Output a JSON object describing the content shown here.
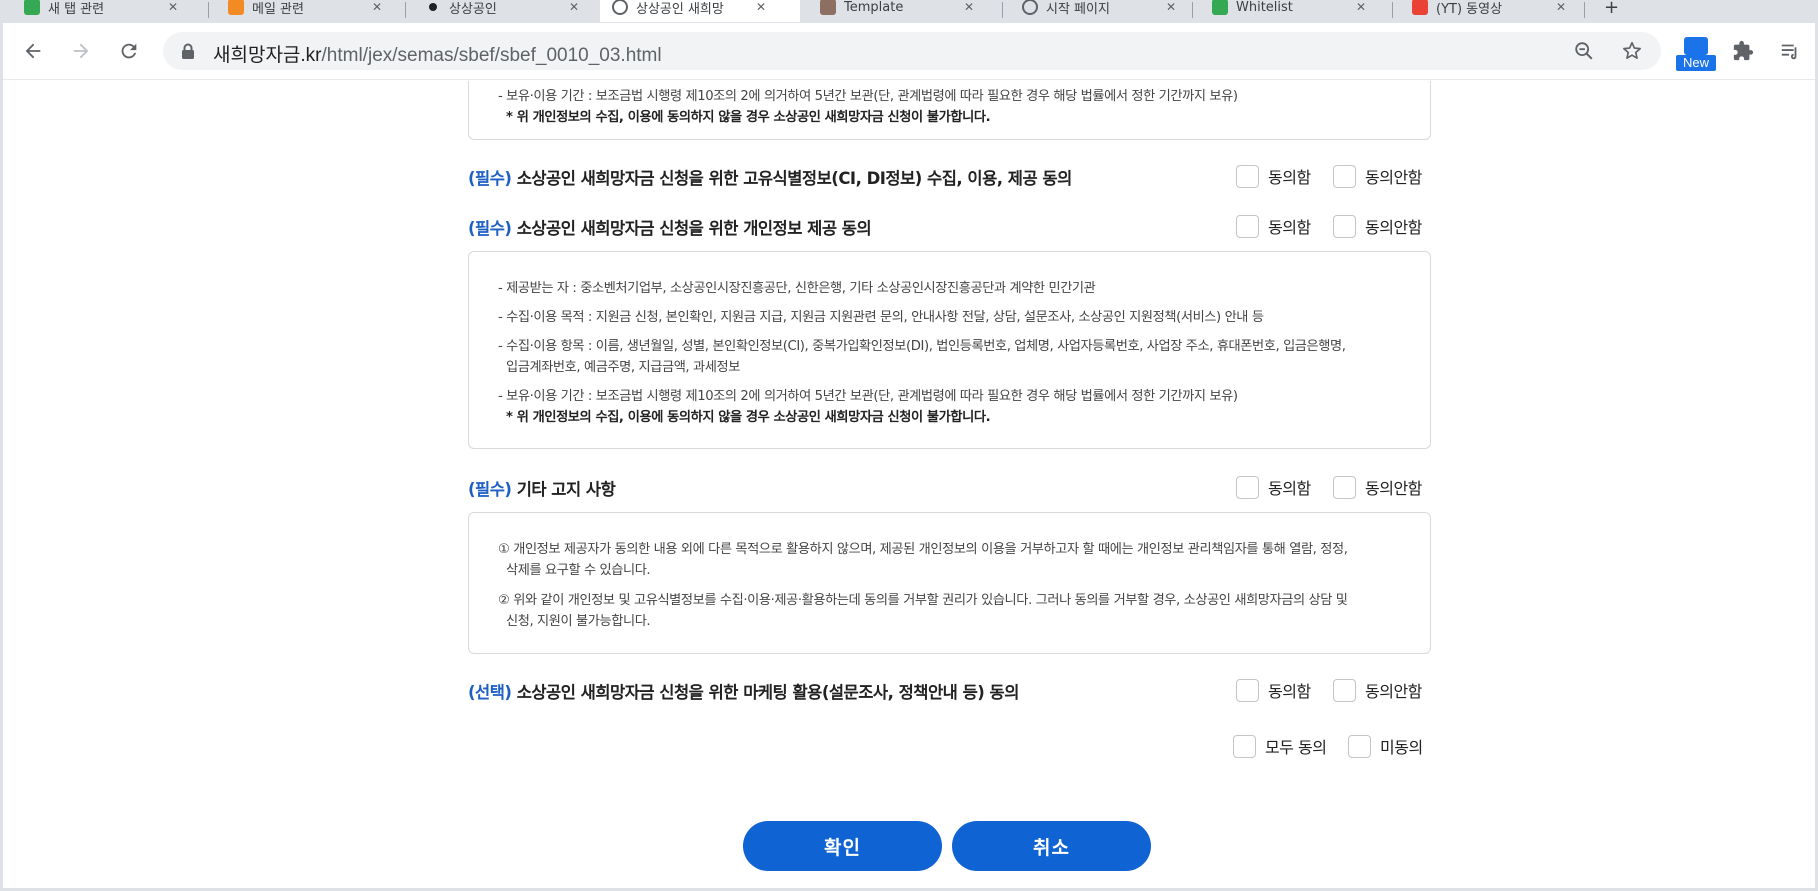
{
  "browser": {
    "tabs": [
      {
        "label": "새 탭 관련",
        "favicon_color": "#34a853"
      },
      {
        "label": "메일 관련",
        "favicon_color": "#f28b24"
      },
      {
        "label": "상상공인",
        "favicon_color": "#202124"
      },
      {
        "label": "상상공인 새희망",
        "favicon_color": "#5f6368"
      },
      {
        "label": "Template",
        "favicon_color": "#8d6e63"
      },
      {
        "label": "시작 페이지",
        "favicon_color": "#5f6368"
      },
      {
        "label": "Whitelist",
        "favicon_color": "#34a853"
      },
      {
        "label": "(YT) 동영상",
        "favicon_color": "#ea4335"
      }
    ],
    "active_tab_index": 3,
    "url_host": "새희망자금.kr",
    "url_path": "/html/jex/semas/sbef/sbef_0010_03.html",
    "new_badge": "New"
  },
  "page": {
    "top_box_lines": [
      "- 보유·이용 기간 : 보조금법 시행령 제10조의 2에 의거하여 5년간 보관(단, 관계법령에 따라 필요한 경우 해당 법률에서 정한 기간까지 보유)",
      "* 위 개인정보의 수집, 이용에 동의하지 않을 경우 소상공인 새희망자금 신청이 불가합니다."
    ],
    "sections": [
      {
        "tag": "(필수)",
        "title": " 소상공인 새희망자금 신청을 위한 고유식별정보(CI, DI정보) 수집, 이용, 제공 동의"
      },
      {
        "tag": "(필수)",
        "title": " 소상공인 새희망자금 신청을 위한 개인정보 제공 동의"
      },
      {
        "tag": "(필수)",
        "title": " 기타 고지 사항"
      },
      {
        "tag": "(선택)",
        "title": " 소상공인 새희망자금 신청을 위한 마케팅 활용(설문조사, 정책안내 등) 동의"
      }
    ],
    "box2_lines": [
      "- 제공받는 자 : 중소벤처기업부, 소상공인시장진흥공단, 신한은행, 기타 소상공인시장진흥공단과 계약한 민간기관",
      "- 수집·이용 목적 : 지원금 신청, 본인확인, 지원금 지급, 지원금 지원관련 문의, 안내사항 전달, 상담, 설문조사, 소상공인 지원정책(서비스) 안내 등",
      "- 수집·이용 항목 : 이름, 생년월일, 성별, 본인확인정보(CI), 중복가입확인정보(DI), 법인등록번호, 업체명, 사업자등록번호, 사업장 주소, 휴대폰번호, 입금은행명,",
      "입금계좌번호, 예금주명, 지급금액, 과세정보",
      "- 보유·이용 기간 : 보조금법 시행령 제10조의 2에 의거하여 5년간 보관(단, 관계법령에 따라 필요한 경우 해당 법률에서 정한 기간까지 보유)",
      "* 위 개인정보의 수집, 이용에 동의하지 않을 경우 소상공인 새희망자금 신청이 불가합니다."
    ],
    "box3_lines": [
      "① 개인정보 제공자가 동의한 내용 외에 다른 목적으로 활용하지 않으며, 제공된 개인정보의 이용을 거부하고자 할 때에는 개인정보 관리책임자를 통해 열람, 정정,",
      "삭제를 요구할 수 있습니다.",
      "② 위와 같이 개인정보 및 고유식별정보를 수집·이용·제공·활용하는데 동의를 거부할 권리가 있습니다. 그러나 동의를 거부할 경우, 소상공인 새희망자금의 상담 및",
      "신청, 지원이 불가능합니다."
    ],
    "agree_label": "동의함",
    "disagree_label": "동의안함",
    "all_agree_label": "모두 동의",
    "none_agree_label": "미동의",
    "confirm_button": "확인",
    "cancel_button": "취소",
    "accent_color": "#1e5fc4",
    "button_color": "#0f63d2"
  }
}
